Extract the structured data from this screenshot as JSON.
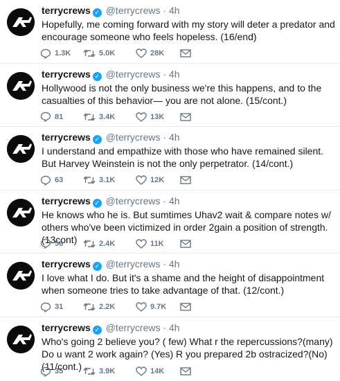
{
  "tweets": [
    {
      "name": "terrycrews",
      "handle": "@terrycrews",
      "time": "4h",
      "text": "Hopefully, me coming forward with my story will deter a predator and encourage someone who feels hopeless. (16/end)",
      "replies": "1.3K",
      "retweets": "5.0K",
      "likes": "28K"
    },
    {
      "name": "terrycrews",
      "handle": "@terrycrews",
      "time": "4h",
      "text": "Hollywood is not the only business we're this happens, and to the casualties of this behavior— you are not alone. (15/cont.)",
      "replies": "81",
      "retweets": "3.4K",
      "likes": "13K"
    },
    {
      "name": "terrycrews",
      "handle": "@terrycrews",
      "time": "4h",
      "text": "I understand and empathize with those who have remained silent. But Harvey Weinstein is not the only perpetrator. (14/cont.)",
      "replies": "63",
      "retweets": "3.1K",
      "likes": "12K"
    },
    {
      "name": "terrycrews",
      "handle": "@terrycrews",
      "time": "4h",
      "text": "He knows who he is. But sumtimes Uhav2 wait & compare notes w/ others who've been victimized in order 2gain a position of strength. (13cont)",
      "replies": "56",
      "retweets": "2.4K",
      "likes": "11K"
    },
    {
      "name": "terrycrews",
      "handle": "@terrycrews",
      "time": "4h",
      "text": "I love what I do. But it's a shame and the height of disappointment when someone tries to take advantage of that. (12/cont.)",
      "replies": "31",
      "retweets": "2.2K",
      "likes": "9.7K"
    },
    {
      "name": "terrycrews",
      "handle": "@terrycrews",
      "time": "4h",
      "text": "Who's going 2 believe you? ( few) What r the repercussions?(many) Do u want 2 work again? (Yes) R you prepared 2b ostracized?(No)(11/cont.)",
      "replies": "35",
      "retweets": "3.9K",
      "likes": "14K"
    }
  ],
  "icons": {
    "avatar": "avatar-logo-icon",
    "verified": "verified-badge-icon",
    "reply": "reply-icon",
    "retweet": "retweet-icon",
    "like": "heart-icon",
    "message": "envelope-icon"
  },
  "colors": {
    "verified": "#1da1f2",
    "muted": "#657786",
    "text": "#14171a",
    "divider": "#e6ecf0"
  }
}
